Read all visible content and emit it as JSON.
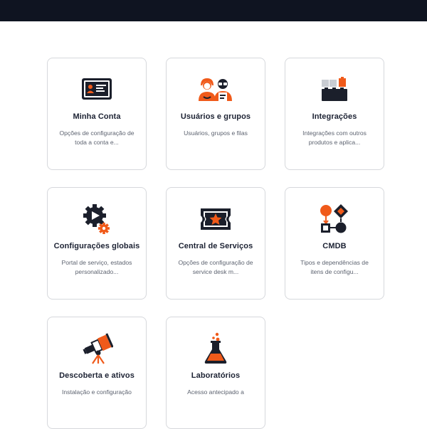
{
  "cards": [
    {
      "title": "Minha Conta",
      "description": "Opções de configuração de toda a conta e...",
      "icon": "account-card-icon"
    },
    {
      "title": "Usuários e grupos",
      "description": "Usuários, grupos e filas",
      "icon": "users-group-icon"
    },
    {
      "title": "Integrações",
      "description": "Integrações com outros produtos e aplica...",
      "icon": "integration-blocks-icon"
    },
    {
      "title": "Configurações globais",
      "description": "Portal de serviço, estados personalizado...",
      "icon": "global-settings-gear-icon"
    },
    {
      "title": "Central de Serviços",
      "description": "Opções de configuração de service desk m...",
      "icon": "service-ticket-icon"
    },
    {
      "title": "CMDB",
      "description": "Tipos e dependências de itens de configu...",
      "icon": "cmdb-flow-icon"
    },
    {
      "title": "Descoberta e ativos",
      "description": "Instalação e configuração",
      "icon": "telescope-icon"
    },
    {
      "title": "Laboratórios",
      "description": "Acesso antecipado a",
      "icon": "lab-flask-icon"
    }
  ],
  "colors": {
    "topbar": "#0f1421",
    "accent": "#f05a1a",
    "dark": "#1b1f2b",
    "card_border": "#d6d8dc"
  }
}
